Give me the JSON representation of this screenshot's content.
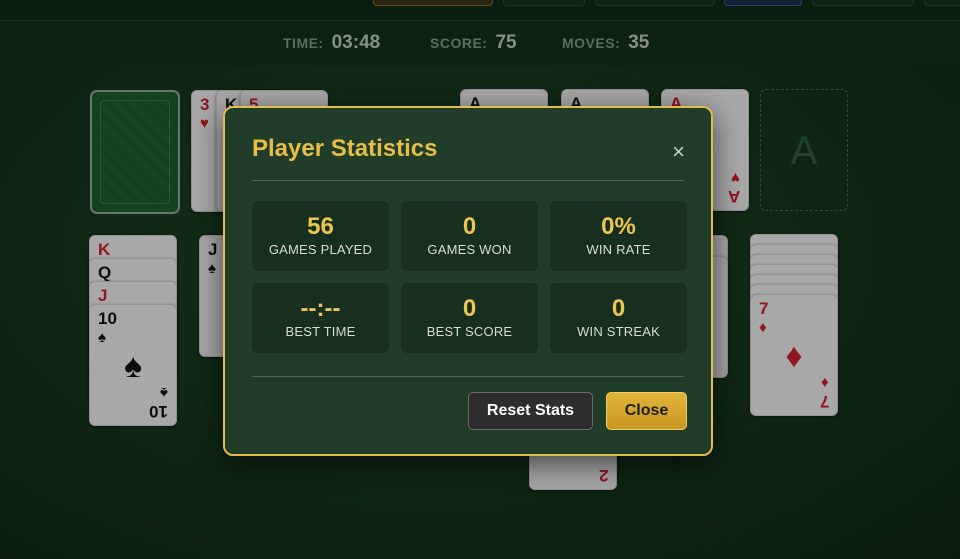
{
  "status": {
    "time_label": "TIME:",
    "time_value": "03:48",
    "score_label": "SCORE:",
    "score_value": "75",
    "moves_label": "MOVES:",
    "moves_value": "35"
  },
  "table": {
    "waste": [
      {
        "rank": "3",
        "suit": "♥"
      },
      {
        "rank": "K",
        "suit": ""
      },
      {
        "rank": "5",
        "suit": ""
      }
    ],
    "foundations": [
      {
        "rank": "A",
        "suit": ""
      },
      {
        "rank": "A",
        "suit": ""
      },
      {
        "rank": "A",
        "suit": "♥"
      }
    ],
    "empty_foundation_label": "A",
    "column1": [
      {
        "rank": "K",
        "suit": ""
      },
      {
        "rank": "Q",
        "suit": ""
      },
      {
        "rank": "J",
        "suit": ""
      },
      {
        "rank": "10",
        "suit": "♠"
      }
    ],
    "column2": [
      {
        "rank": "J",
        "suit": "♠"
      }
    ],
    "column_right": [
      {
        "rank": "7",
        "suit": "♦"
      }
    ],
    "bottom_card": {
      "rank": "2"
    }
  },
  "modal": {
    "title": "Player Statistics",
    "close_icon": "×",
    "stats": [
      {
        "value": "56",
        "label": "GAMES PLAYED"
      },
      {
        "value": "0",
        "label": "GAMES WON"
      },
      {
        "value": "0%",
        "label": "WIN RATE"
      },
      {
        "value": "--:--",
        "label": "BEST TIME"
      },
      {
        "value": "0",
        "label": "BEST SCORE"
      },
      {
        "value": "0",
        "label": "WIN STREAK"
      }
    ],
    "reset_label": "Reset Stats",
    "close_label": "Close"
  },
  "colors": {
    "felt": "#1c4424",
    "accent_gold": "#e8bd45",
    "tile_bg": "#162f1e",
    "card_red": "#c8202a"
  }
}
